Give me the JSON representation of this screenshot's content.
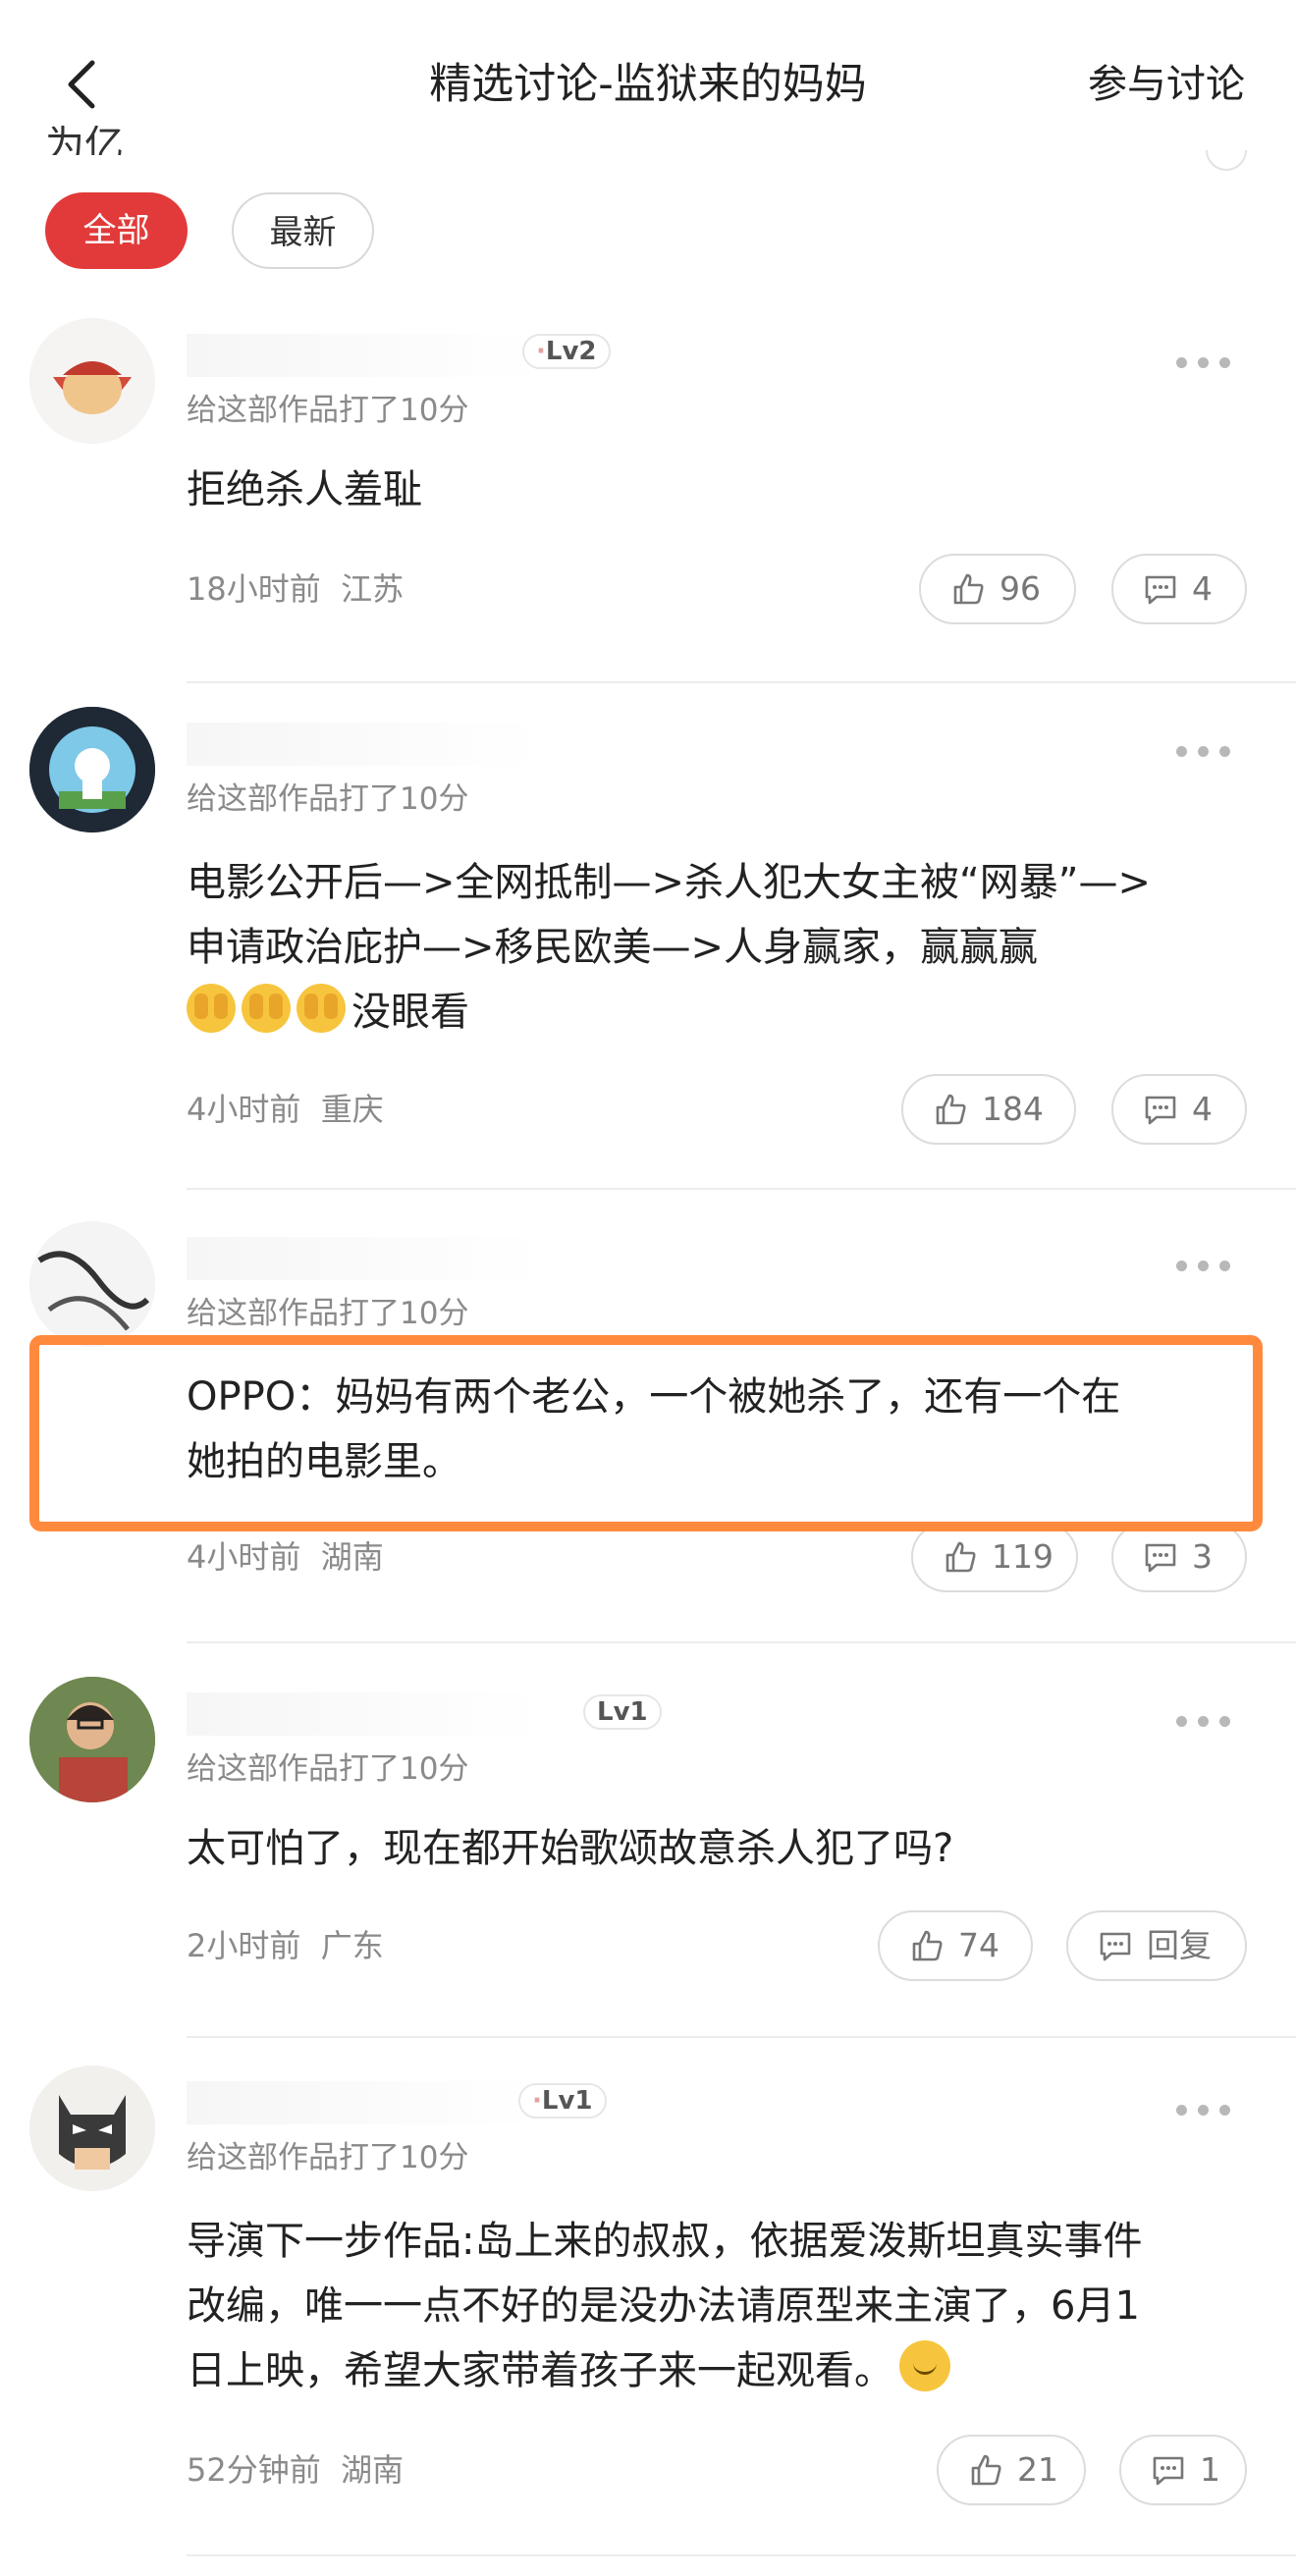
{
  "header": {
    "title": "精选讨论-监狱来的妈妈",
    "join_label": "参与讨论",
    "peek_text": "为亿"
  },
  "tabs": [
    {
      "label": "全部",
      "active": true
    },
    {
      "label": "最新",
      "active": false
    }
  ],
  "comments": [
    {
      "level": "Lv2",
      "rated": "给这部作品打了10分",
      "content": "拒绝杀人羞耻",
      "time": "18小时前",
      "location": "江苏",
      "likes": "96",
      "reply": "4"
    },
    {
      "level": "",
      "rated": "给这部作品打了10分",
      "content_line1": "电影公开后—>全网抵制—>杀人犯大女主被“网暴”—>",
      "content_line2": "申请政治庇护—>移民欧美—>人身赢家，赢赢赢",
      "content_line3": "没眼看",
      "time": "4小时前",
      "location": "重庆",
      "likes": "184",
      "reply": "4"
    },
    {
      "level": "",
      "rated": "给这部作品打了10分",
      "content_line1": "OPPO：妈妈有两个老公，一个被她杀了，还有一个在",
      "content_line2": "她拍的电影里。",
      "time": "4小时前",
      "location": "湖南",
      "likes": "119",
      "reply": "3"
    },
    {
      "level": "Lv1",
      "rated": "给这部作品打了10分",
      "content": "太可怕了，现在都开始歌颂故意杀人犯了吗?",
      "time": "2小时前",
      "location": "广东",
      "likes": "74",
      "reply": "回复"
    },
    {
      "level": "Lv1",
      "rated": "给这部作品打了10分",
      "content_line1": "导演下一步作品:岛上来的叔叔，依据爱泼斯坦真实事件",
      "content_line2": "改编，唯一一点不好的是没办法请原型来主演了，6月1",
      "content_line3": "日上映，希望大家带着孩子来一起观看。",
      "time": "52分钟前",
      "location": "湖南",
      "likes": "21",
      "reply": "1"
    }
  ],
  "colors": {
    "accent": "#e23a3a",
    "highlight": "#ff8a3d",
    "meta": "#8a8a8a"
  }
}
